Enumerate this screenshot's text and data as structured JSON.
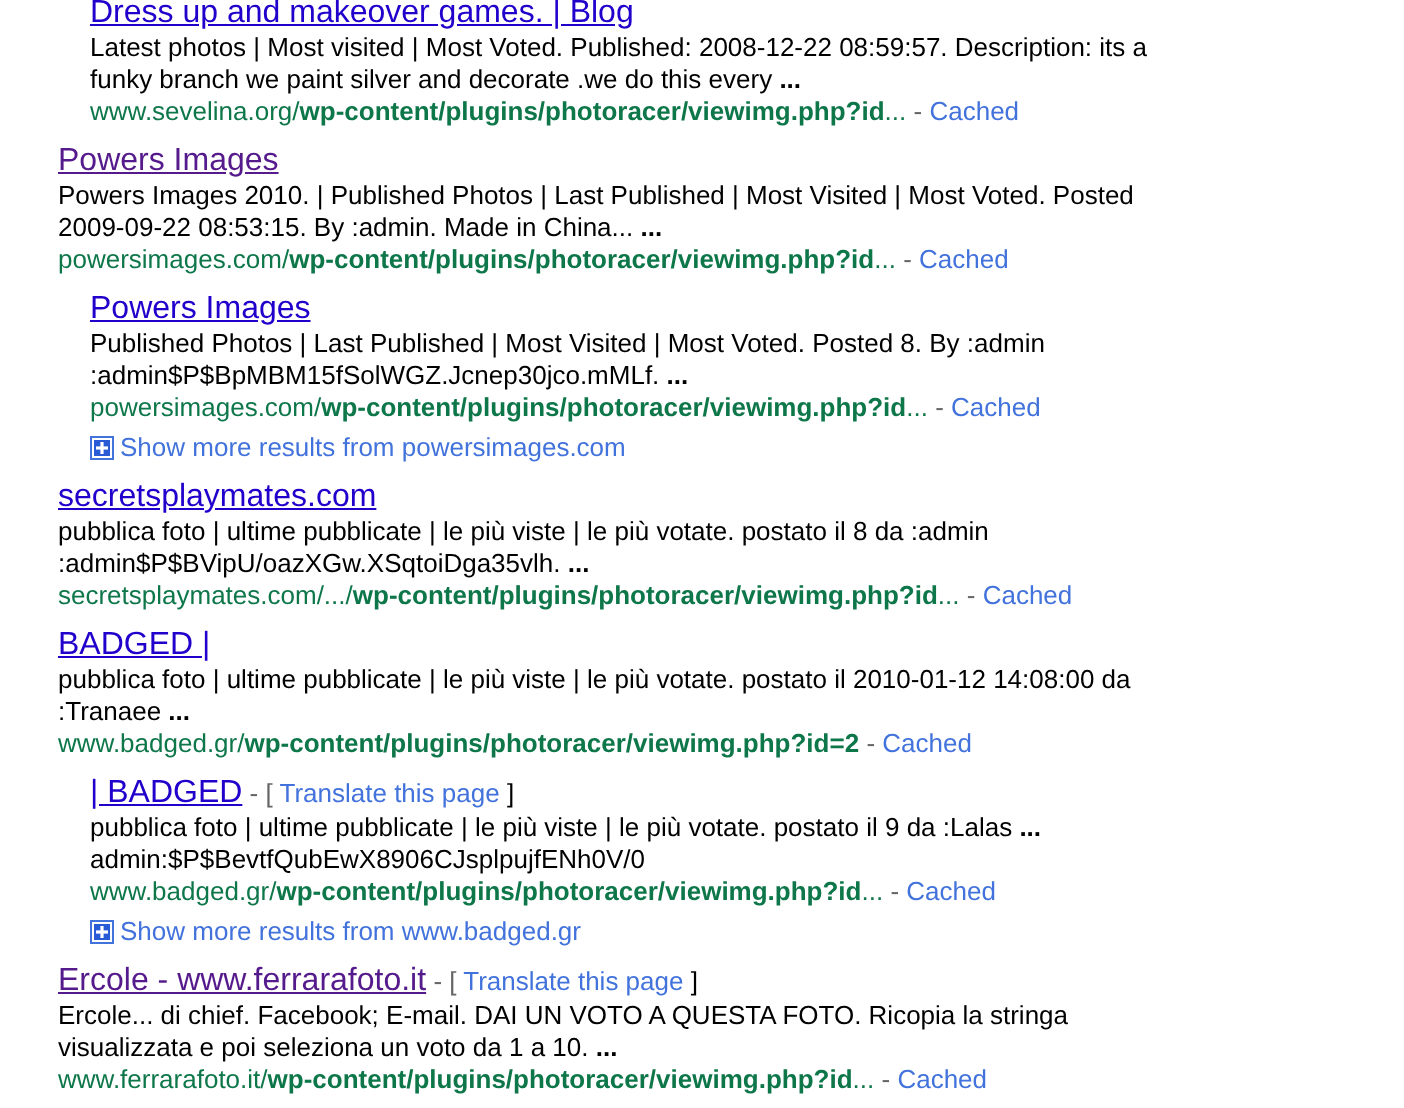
{
  "results": [
    {
      "indented": true,
      "visited": false,
      "title": "Dress up and makeover games. | Blog",
      "snippet": "Latest photos | Most visited | Most Voted. Published: 2008-12-22 08:59:57. Description: its a funky branch we paint silver and decorate .we do this every **...**",
      "url": "www.sevelina.org/**wp-content/plugins/photoracer/viewimg.php?id**...",
      "separator": "-",
      "cached": "Cached"
    },
    {
      "indented": false,
      "visited": true,
      "title": "Powers Images",
      "snippet": "Powers Images 2010. | Published Photos | Last Published | Most Visited | Most Voted. Posted 2009-09-22 08:53:15. By :admin. Made in China... **...**",
      "url": "powersimages.com/**wp-content/plugins/photoracer/viewimg.php?id**...",
      "separator": "-",
      "cached": "Cached"
    },
    {
      "indented": true,
      "visited": false,
      "title": "Powers Images",
      "snippet": "Published Photos | Last Published | Most Visited | Most Voted. Posted 8. By :admin :admin$P$BpMBM15fSolWGZ.Jcnep30jco.mMLf. **...**",
      "url": "powersimages.com/**wp-content/plugins/photoracer/viewimg.php?id**...",
      "separator": "-",
      "cached": "Cached",
      "more": "Show more results from powersimages.com"
    },
    {
      "indented": false,
      "visited": false,
      "title": "secretsplaymates.com",
      "snippet": "pubblica foto | ultime pubblicate | le più viste | le più votate. postato il 8 da :admin :admin$P$BVipU/oazXGw.XSqtoiDga35vlh. **...**",
      "url": "secretsplaymates.com/.../**wp-content/plugins/photoracer/viewimg.php?id**...",
      "separator": "-",
      "cached": "Cached"
    },
    {
      "indented": false,
      "visited": false,
      "title": "BADGED |",
      "snippet": "pubblica foto | ultime pubblicate | le più viste | le più votate. postato il 2010-01-12 14:08:00 da :Tranaee **...**",
      "url": "www.badged.gr/**wp-content/plugins/photoracer/viewimg.php?id=2**",
      "separator": "-",
      "cached": "Cached"
    },
    {
      "indented": true,
      "visited": false,
      "title": "| BADGED",
      "translate": {
        "open": "- [",
        "link": "Translate this page",
        "close": "]"
      },
      "snippet": "pubblica foto | ultime pubblicate | le più viste | le più votate. postato il 9 da :Lalas **...** admin:$P$BevtfQubEwX8906CJsplpujfENh0V/0",
      "url": "www.badged.gr/**wp-content/plugins/photoracer/viewimg.php?id**...",
      "separator": "-",
      "cached": "Cached",
      "more": "Show more results from www.badged.gr"
    },
    {
      "indented": false,
      "visited": true,
      "title": "Ercole - www.ferrarafoto.it",
      "translate": {
        "open": "- [",
        "link": "Translate this page",
        "close": "]"
      },
      "snippet": "Ercole... di chief. Facebook; E-mail. DAI UN VOTO A QUESTA FOTO. Ricopia la stringa visualizzata e poi seleziona un voto da 1 a 10. **...**",
      "url": "www.ferrarafoto.it/**wp-content/plugins/photoracer/viewimg.php?id**...",
      "separator": "-",
      "cached": "Cached"
    }
  ]
}
